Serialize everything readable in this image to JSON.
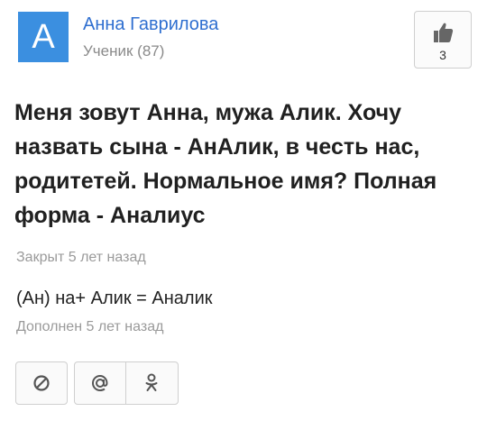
{
  "author": {
    "avatar_letter": "A",
    "name": "Анна Гаврилова",
    "rank": "Ученик (87)"
  },
  "like": {
    "icon": "thumbs-up-icon",
    "count": "3"
  },
  "question": {
    "text": "Меня зовут Анна, мужа Алик. Хочу назвать сына - АнАлик, в честь нас, родитетей. Нормальное имя? Полная форма - Аналиус"
  },
  "status": {
    "closed": "Закрыт 5 лет назад"
  },
  "addition": {
    "text": "(Ан) на+ Алик = Аналик",
    "time": "Дополнен 5 лет назад"
  },
  "actions": [
    {
      "icon": "block-icon"
    },
    {
      "icon": "at-sign-icon"
    },
    {
      "icon": "odnoklassniki-icon"
    }
  ],
  "colors": {
    "avatar_bg": "#3b8fe0",
    "name_link": "#2f6fd0",
    "muted_text": "#9a9a9a"
  }
}
